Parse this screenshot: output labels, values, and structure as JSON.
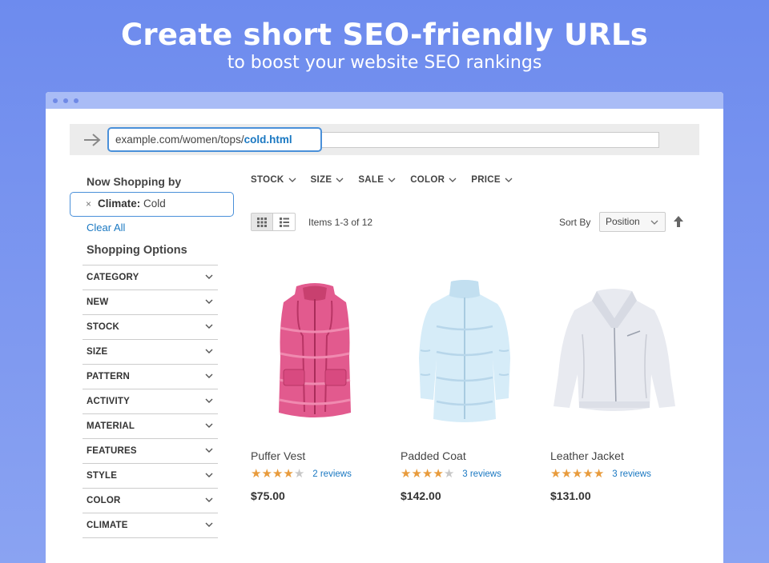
{
  "banner": {
    "title": "Create short SEO-friendly URLs",
    "subtitle": "to boost your website SEO rankings"
  },
  "address_bar": {
    "url_prefix": "example.com/women/tops/",
    "url_highlight": "cold.html"
  },
  "sidebar": {
    "now_shopping_heading": "Now Shopping by",
    "active_filter": {
      "label": "Climate:",
      "value": "Cold",
      "remove_icon": "×"
    },
    "clear_all": "Clear All",
    "shopping_options_heading": "Shopping Options",
    "options": [
      "CATEGORY",
      "NEW",
      "STOCK",
      "SIZE",
      "PATTERN",
      "ACTIVITY",
      "MATERIAL",
      "FEATURES",
      "STYLE",
      "COLOR",
      "CLIMATE"
    ]
  },
  "top_filters": [
    "STOCK",
    "SIZE",
    "SALE",
    "COLOR",
    "PRICE"
  ],
  "toolbar": {
    "items_count": "Items 1-3 of 12",
    "sort_label": "Sort By",
    "sort_value": "Position",
    "view_modes": [
      "grid-icon",
      "list-icon"
    ],
    "sort_direction_icon": "arrow-up-icon"
  },
  "products": [
    {
      "name": "Puffer Vest",
      "rating": 4,
      "reviews": "2 reviews",
      "price": "$75.00",
      "color": "#e0508a",
      "icon": "puffer-vest-image"
    },
    {
      "name": "Padded Coat",
      "rating": 4,
      "reviews": "3 reviews",
      "price": "$142.00",
      "color": "#d4eaf7",
      "icon": "padded-coat-image"
    },
    {
      "name": "Leather Jacket",
      "rating": 5,
      "reviews": "3 reviews",
      "price": "$131.00",
      "color": "#e6e8ef",
      "icon": "leather-jacket-image"
    }
  ],
  "colors": {
    "link": "#1a78c2",
    "accent_border": "#4a90d9",
    "star": "#e89b3c",
    "background": "#6d8bee"
  }
}
